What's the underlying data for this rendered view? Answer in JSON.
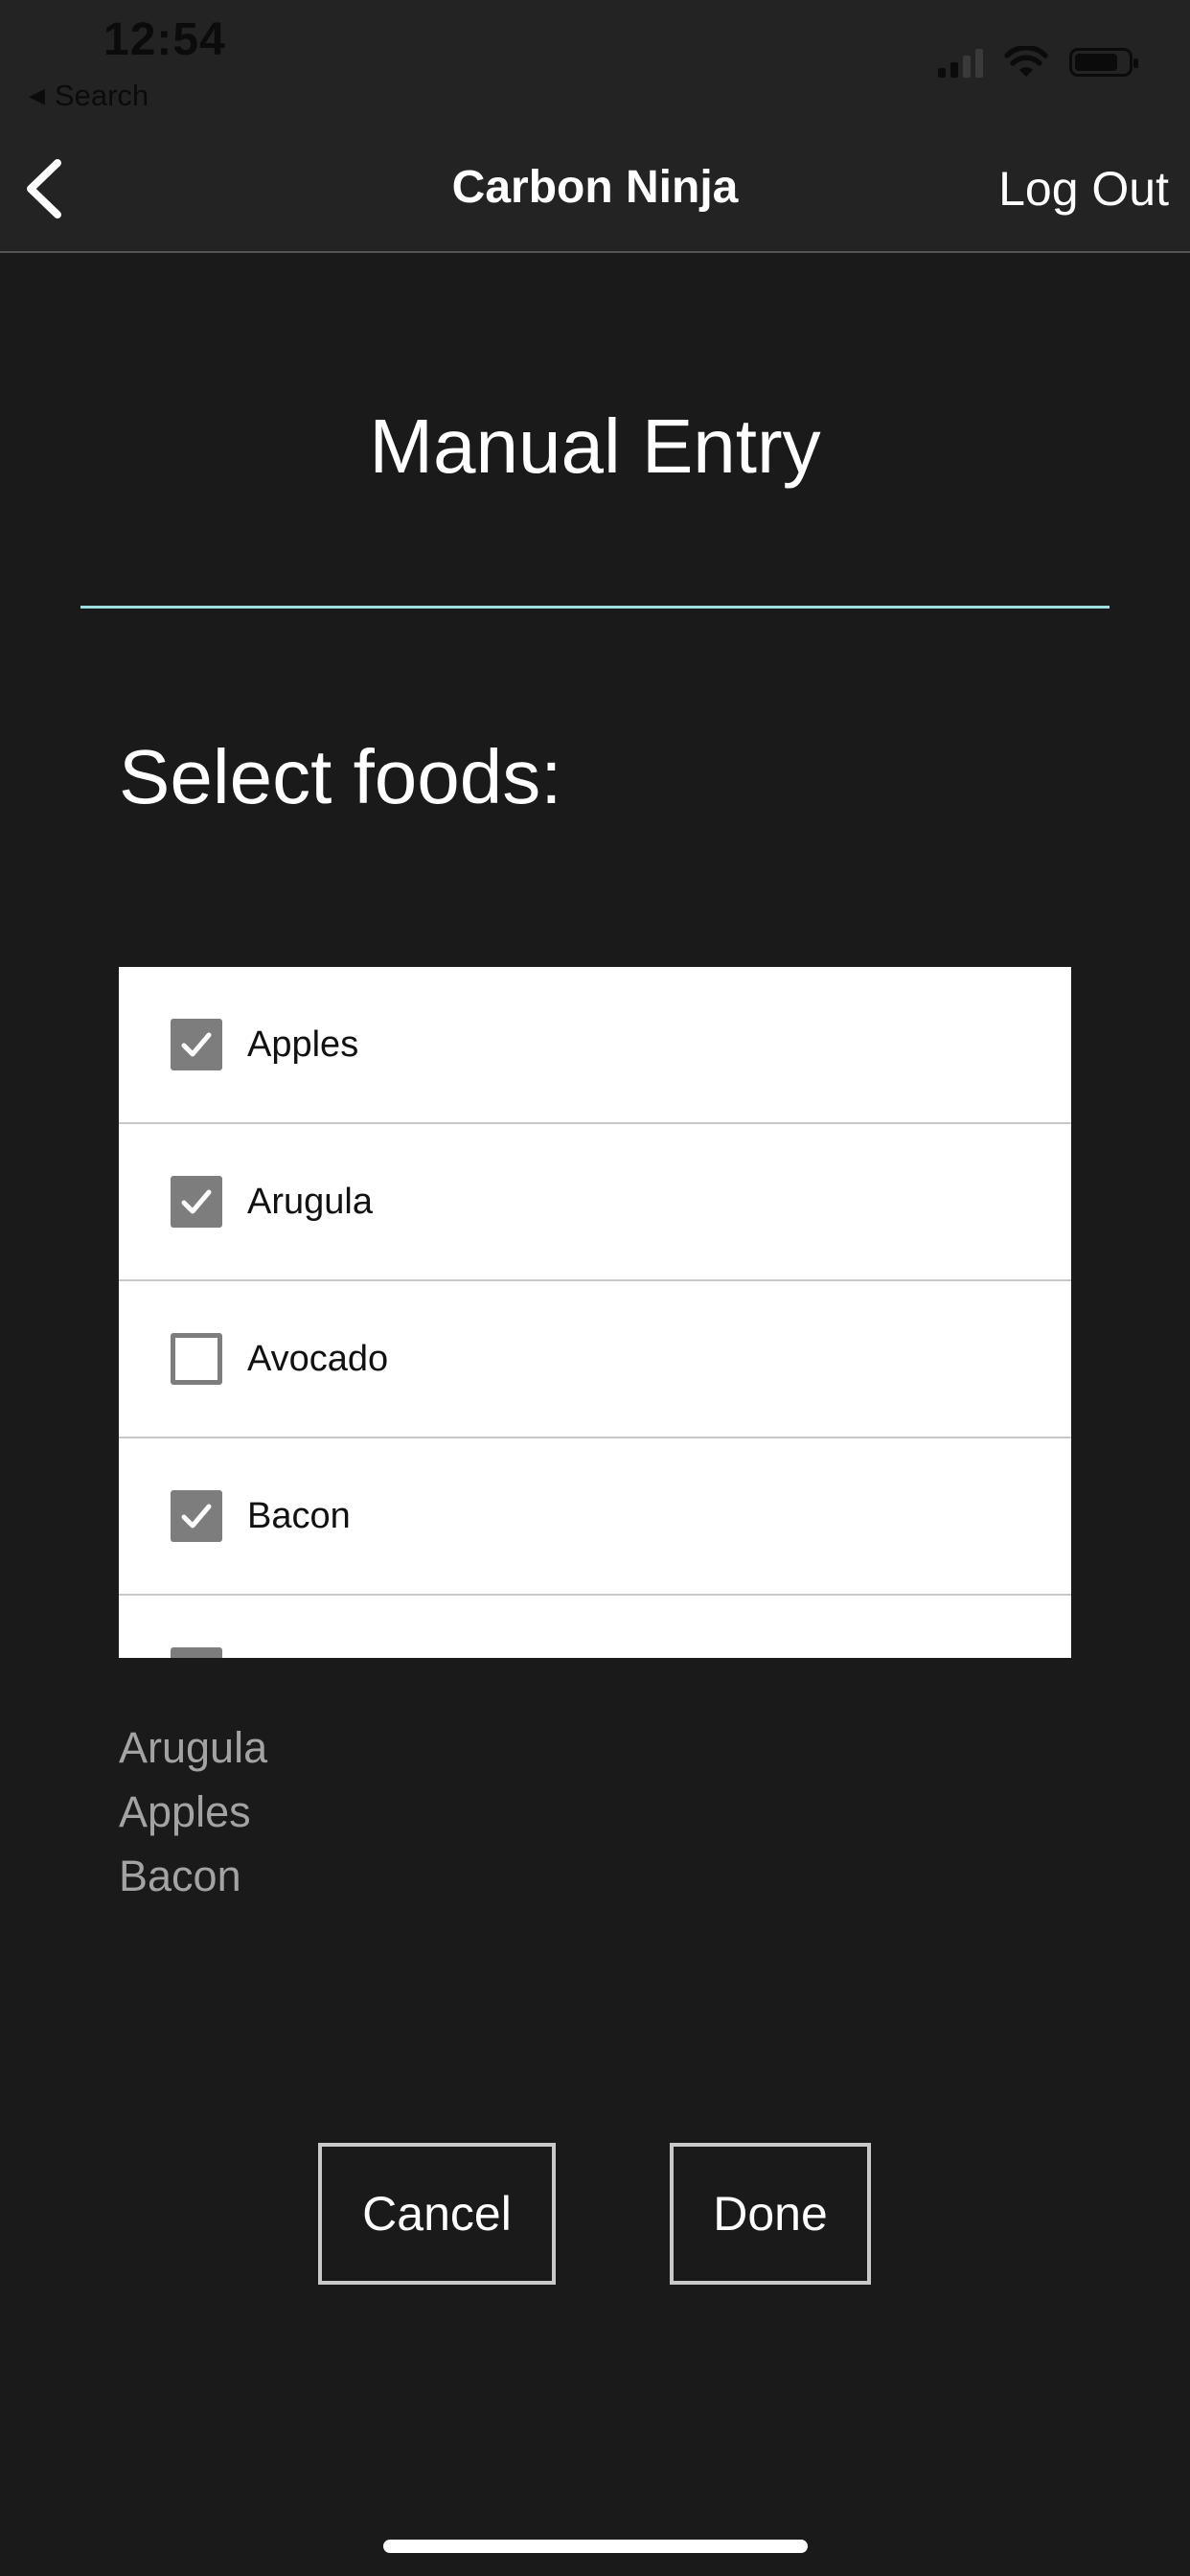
{
  "status_bar": {
    "time": "12:54",
    "back_app": "Search",
    "back_icon": "back-triangle-icon",
    "signal_icon": "cellular-signal-icon",
    "wifi_icon": "wifi-icon",
    "battery_icon": "battery-icon"
  },
  "nav": {
    "back_icon": "chevron-left-icon",
    "title": "Carbon Ninja",
    "logout_label": "Log Out"
  },
  "main": {
    "heading": "Manual Entry",
    "divider_color": "#9fdede",
    "select_label": "Select foods:",
    "foods": [
      {
        "label": "Apples",
        "checked": true
      },
      {
        "label": "Arugula",
        "checked": true
      },
      {
        "label": "Avocado",
        "checked": false
      },
      {
        "label": "Bacon",
        "checked": true
      },
      {
        "label": "",
        "checked": true
      }
    ],
    "selected": [
      "Arugula",
      "Apples",
      "Bacon"
    ],
    "cancel_label": "Cancel",
    "done_label": "Done"
  },
  "colors": {
    "background": "#1a1a1a",
    "bar_background": "#232323",
    "checkbox": "#7d7d7d",
    "selected_text": "#a3a3a3"
  }
}
